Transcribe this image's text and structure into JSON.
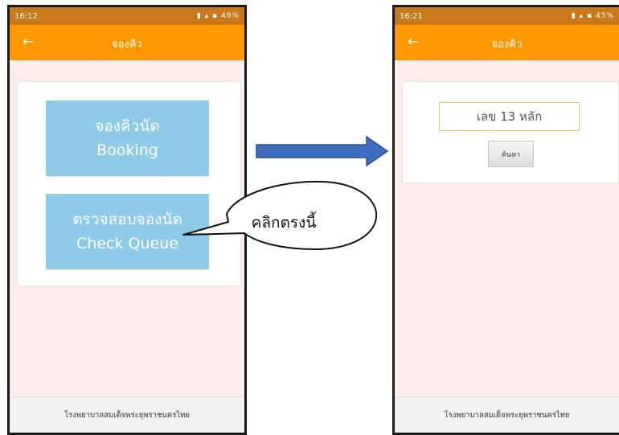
{
  "left_screen": {
    "status_time": "16:12",
    "status_right": "48%",
    "title": "จองคิว",
    "back_glyph": "←",
    "booking_button": {
      "line1": "จองคิวนัด",
      "line2": "Booking"
    },
    "check_button": {
      "line1": "ตรวจสอบจองนัด",
      "line2": "Check Queue"
    },
    "footer": "โรงพยาบาลสมเด็จพระยุพราชนครไทย"
  },
  "right_screen": {
    "status_time": "16:21",
    "status_right": "45%",
    "title": "จองคิว",
    "back_glyph": "←",
    "id_input_placeholder": "เลข 13 หลัก",
    "search_label": "ค้นหา",
    "footer": "โรงพยาบาลสมเด็จพระยุพราชนครไทย"
  },
  "callout": {
    "text": "คลิกตรงนี้"
  },
  "colors": {
    "appbar": "#ff9800",
    "statusbar": "#c9781a",
    "button": "#8ecbe8",
    "page_bg": "#fdecec",
    "arrow": "#3d6cc0"
  },
  "icons": {
    "back": "back-arrow-icon",
    "flow": "arrow-right-icon"
  }
}
